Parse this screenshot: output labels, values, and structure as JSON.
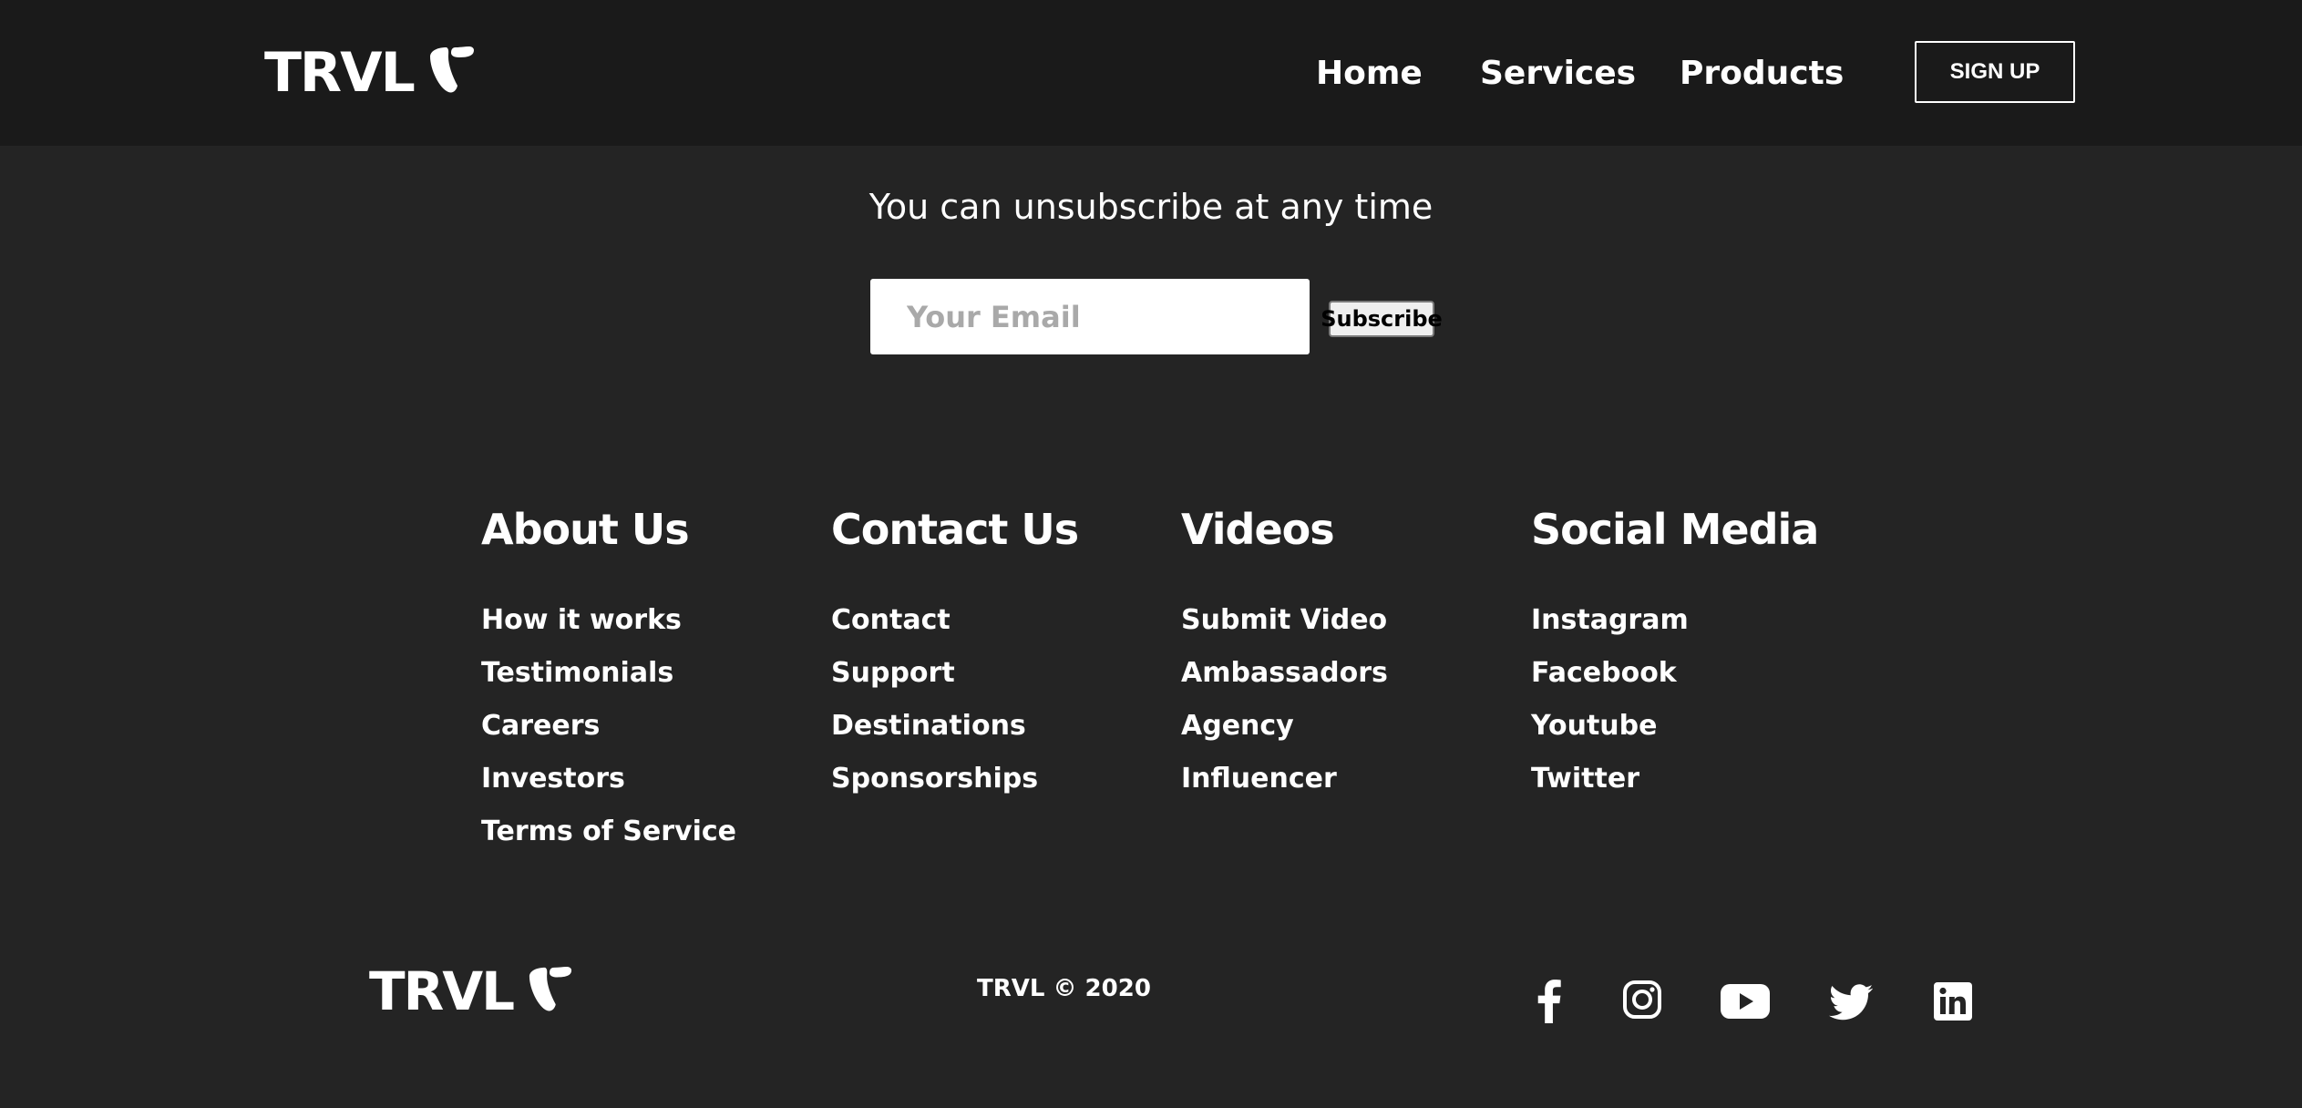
{
  "navbar": {
    "logo_text": "TRVL",
    "links": [
      "Home",
      "Services",
      "Products"
    ],
    "signup_label": "SIGN UP"
  },
  "newsletter": {
    "message": "You can unsubscribe at any time",
    "email_placeholder": "Your Email",
    "subscribe_label": "Subscribe"
  },
  "footer": {
    "columns": [
      {
        "heading": "About Us",
        "links": [
          "How it works",
          "Testimonials",
          "Careers",
          "Investors",
          "Terms of Service"
        ]
      },
      {
        "heading": "Contact Us",
        "links": [
          "Contact",
          "Support",
          "Destinations",
          "Sponsorships"
        ]
      },
      {
        "heading": "Videos",
        "links": [
          "Submit Video",
          "Ambassadors",
          "Agency",
          "Influencer"
        ]
      },
      {
        "heading": "Social Media",
        "links": [
          "Instagram",
          "Facebook",
          "Youtube",
          "Twitter"
        ]
      }
    ],
    "logo_text": "TRVL",
    "copyright": "TRVL © 2020",
    "social_icons": [
      "facebook-icon",
      "instagram-icon",
      "youtube-icon",
      "twitter-icon",
      "linkedin-icon"
    ]
  },
  "colors": {
    "navbar_bg": "#1a1a1a",
    "page_bg": "#242424",
    "text": "#ffffff"
  }
}
